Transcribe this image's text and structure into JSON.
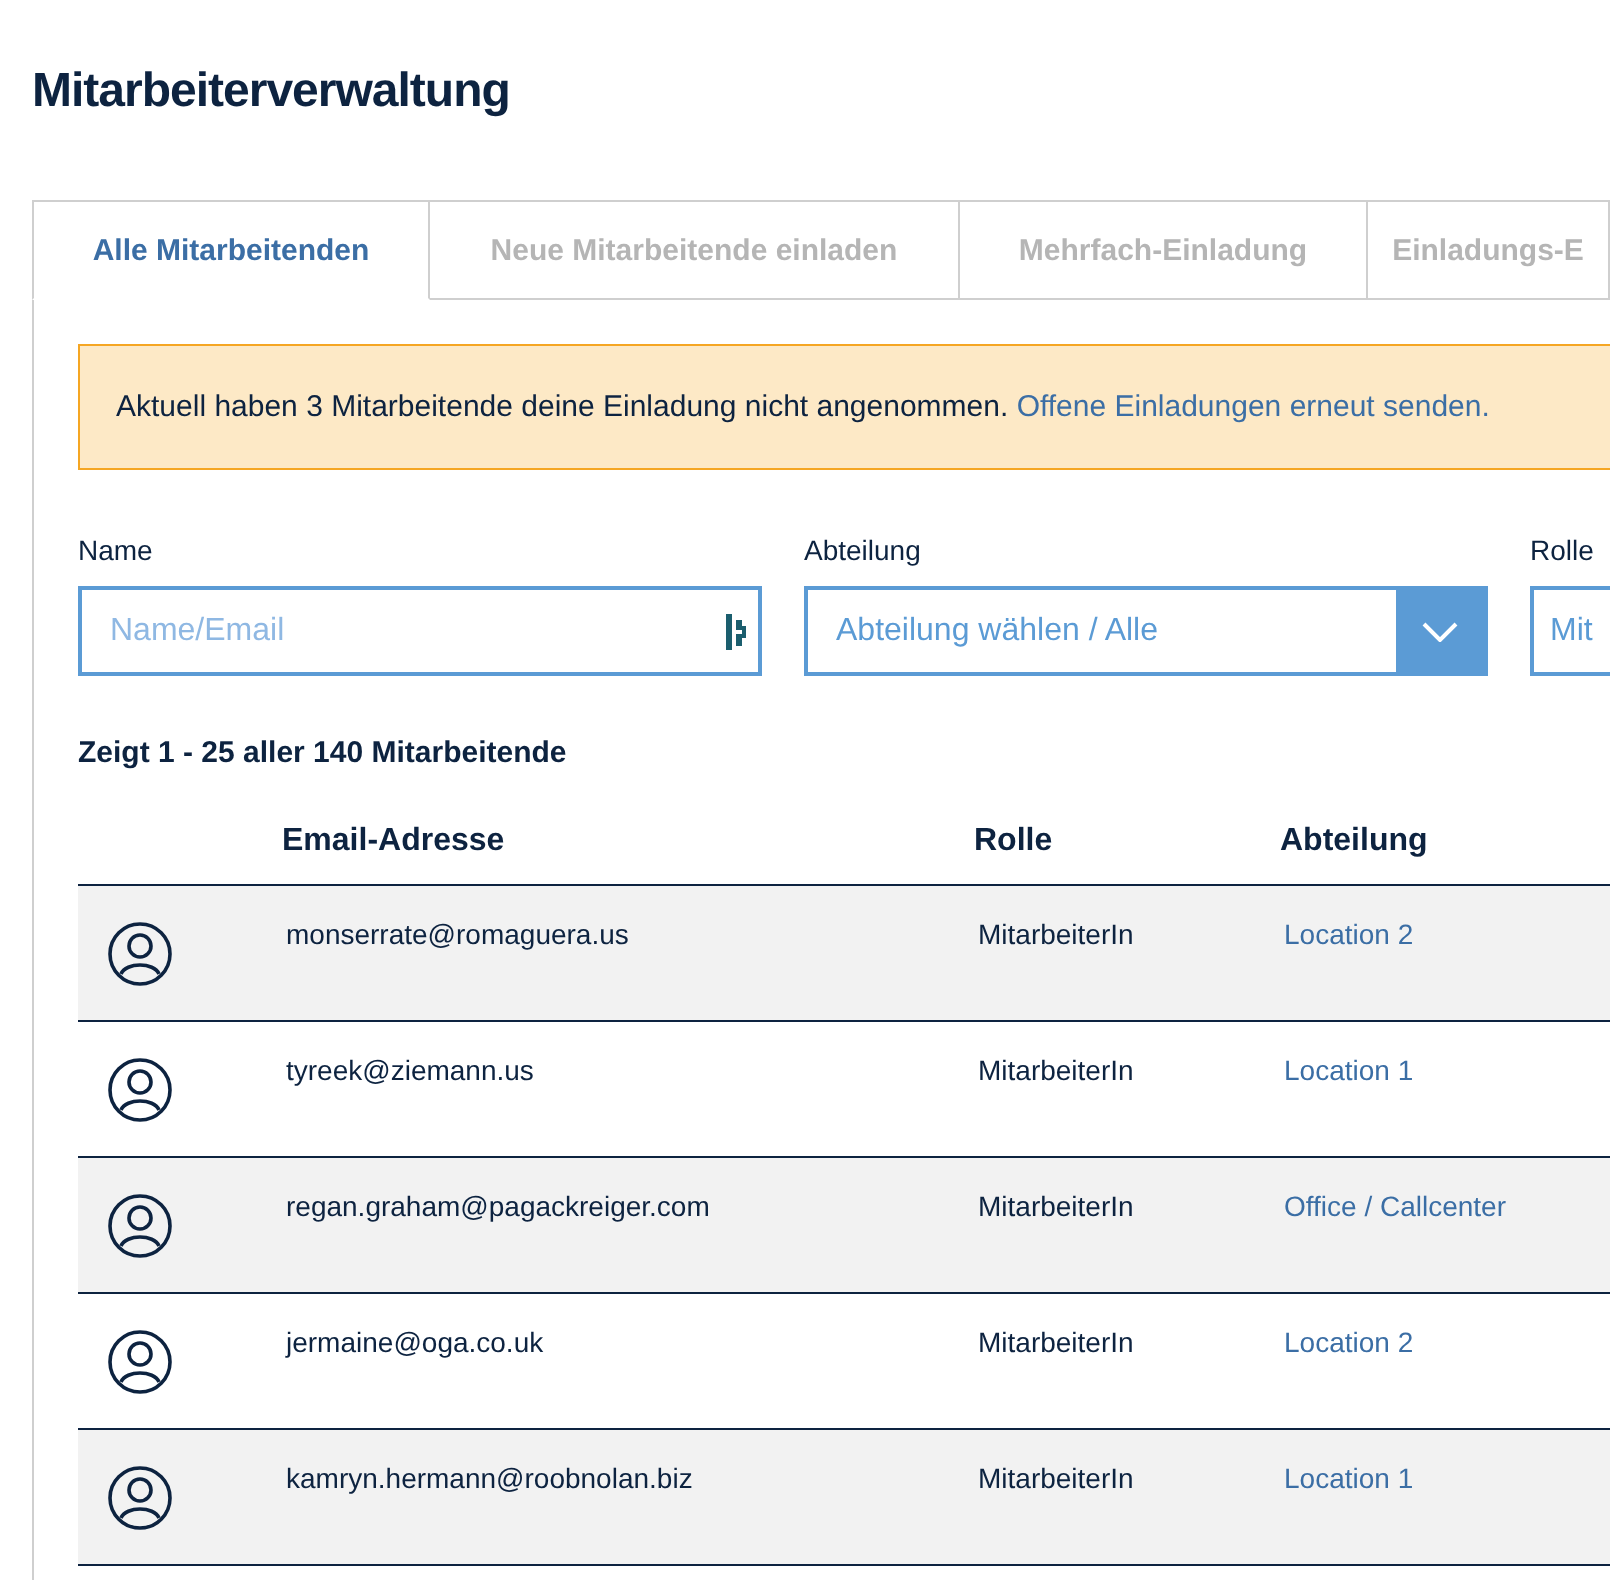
{
  "title": "Mitarbeiterverwaltung",
  "tabs": [
    {
      "label": "Alle Mitarbeitenden",
      "selected": true
    },
    {
      "label": "Neue Mitarbeitende einladen",
      "selected": false
    },
    {
      "label": "Mehrfach-Einladung",
      "selected": false
    },
    {
      "label": "Einladungs-E",
      "selected": false
    }
  ],
  "notice": {
    "text": "Aktuell haben 3 Mitarbeitende deine Einladung nicht angenommen.",
    "link": "Offene Einladungen erneut senden."
  },
  "filters": [
    {
      "kind": "text",
      "label": "Name",
      "placeholder": "Name/Email"
    },
    {
      "kind": "select",
      "label": "Abteilung",
      "placeholder": "Abteilung wählen / Alle"
    },
    {
      "kind": "select",
      "label": "Rolle",
      "placeholder": "Mit"
    }
  ],
  "count": "Zeigt 1 - 25 aller 140 Mitarbeitende",
  "table": {
    "columns": [
      "Email-Adresse",
      "Rolle",
      "Abteilung"
    ],
    "rows": [
      {
        "email": "monserrate@romaguera.us",
        "role": "MitarbeiterIn",
        "department": "Location 2"
      },
      {
        "email": "tyreek@ziemann.us",
        "role": "MitarbeiterIn",
        "department": "Location 1"
      },
      {
        "email": "regan.graham@pagackreiger.com",
        "role": "MitarbeiterIn",
        "department": "Office / Callcenter"
      },
      {
        "email": "jermaine@oga.co.uk",
        "role": "MitarbeiterIn",
        "department": "Location 2"
      },
      {
        "email": "kamryn.hermann@roobnolan.biz",
        "role": "MitarbeiterIn",
        "department": "Location 1"
      }
    ]
  }
}
